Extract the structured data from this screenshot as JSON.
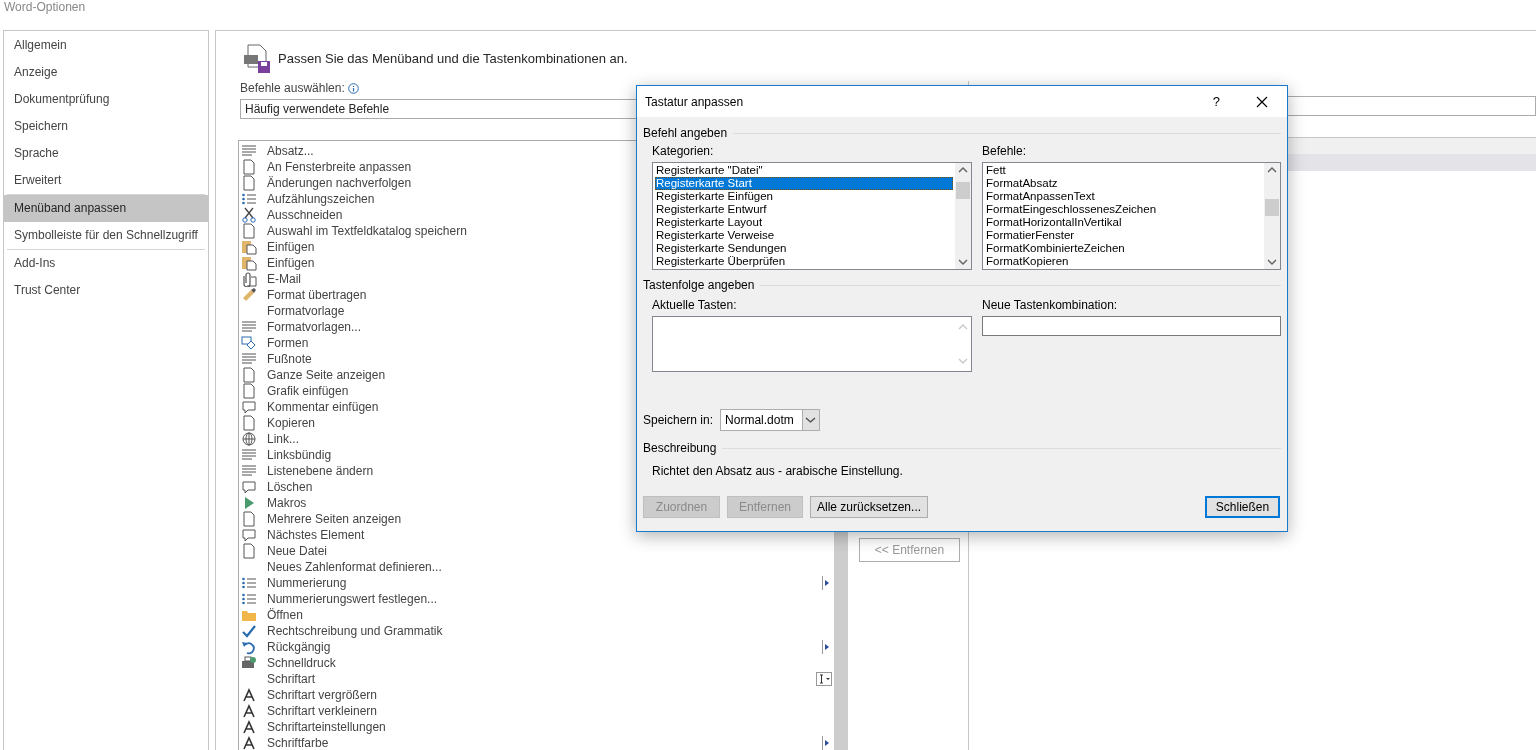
{
  "window": {
    "title": "Word-Optionen"
  },
  "sidebar": {
    "items": [
      {
        "label": "Allgemein",
        "selected": false,
        "divider_above": false
      },
      {
        "label": "Anzeige",
        "selected": false,
        "divider_above": false
      },
      {
        "label": "Dokumentprüfung",
        "selected": false,
        "divider_above": false
      },
      {
        "label": "Speichern",
        "selected": false,
        "divider_above": false
      },
      {
        "label": "Sprache",
        "selected": false,
        "divider_above": false
      },
      {
        "label": "Erweitert",
        "selected": false,
        "divider_above": false
      },
      {
        "label": "Menüband anpassen",
        "selected": true,
        "divider_above": true
      },
      {
        "label": "Symbolleiste für den Schnellzugriff",
        "selected": false,
        "divider_above": false
      },
      {
        "label": "Add-Ins",
        "selected": false,
        "divider_above": true
      },
      {
        "label": "Trust Center",
        "selected": false,
        "divider_above": false
      }
    ]
  },
  "main": {
    "heading": "Passen Sie das Menüband und die Tastenkombinationen an.",
    "select_label": "Befehle auswählen:",
    "select_value": "Häufig verwendete Befehle",
    "commands": [
      {
        "label": "Absatz..."
      },
      {
        "label": "An Fensterbreite anpassen"
      },
      {
        "label": "Änderungen nachverfolgen"
      },
      {
        "label": "Aufzählungszeichen"
      },
      {
        "label": "Ausschneiden"
      },
      {
        "label": "Auswahl im Textfeldkatalog speichern"
      },
      {
        "label": "Einfügen"
      },
      {
        "label": "Einfügen"
      },
      {
        "label": "E-Mail"
      },
      {
        "label": "Format übertragen"
      },
      {
        "label": "Formatvorlage"
      },
      {
        "label": "Formatvorlagen..."
      },
      {
        "label": "Formen"
      },
      {
        "label": "Fußnote"
      },
      {
        "label": "Ganze Seite anzeigen"
      },
      {
        "label": "Grafik einfügen"
      },
      {
        "label": "Kommentar einfügen"
      },
      {
        "label": "Kopieren"
      },
      {
        "label": "Link..."
      },
      {
        "label": "Linksbündig"
      },
      {
        "label": "Listenebene ändern"
      },
      {
        "label": "Löschen"
      },
      {
        "label": "Makros"
      },
      {
        "label": "Mehrere Seiten anzeigen"
      },
      {
        "label": "Nächstes Element"
      },
      {
        "label": "Neue Datei"
      },
      {
        "label": "Neues Zahlenformat definieren..."
      },
      {
        "label": "Nummerierung",
        "kind": "arrow"
      },
      {
        "label": "Nummerierungswert festlegen..."
      },
      {
        "label": "Öffnen"
      },
      {
        "label": "Rechtschreibung und Grammatik"
      },
      {
        "label": "Rückgängig",
        "kind": "arrow"
      },
      {
        "label": "Schnelldruck"
      },
      {
        "label": "Schriftart",
        "kind": "field"
      },
      {
        "label": "Schriftart vergrößern"
      },
      {
        "label": "Schriftart verkleinern"
      },
      {
        "label": "Schriftarteinstellungen"
      },
      {
        "label": "Schriftfarbe",
        "kind": "arrow"
      }
    ],
    "remove_button": {
      "label": "<< Entfernen",
      "disabled": true
    }
  },
  "dialog": {
    "title": "Tastatur anpassen",
    "help": "?",
    "command_section": "Befehl angeben",
    "categories": {
      "label": "Kategorien:",
      "items": [
        {
          "label": "Registerkarte \"Datei\"",
          "selected": false
        },
        {
          "label": "Registerkarte Start",
          "selected": true
        },
        {
          "label": "Registerkarte Einfügen",
          "selected": false
        },
        {
          "label": "Registerkarte Entwurf",
          "selected": false
        },
        {
          "label": "Registerkarte Layout",
          "selected": false
        },
        {
          "label": "Registerkarte Verweise",
          "selected": false
        },
        {
          "label": "Registerkarte Sendungen",
          "selected": false
        },
        {
          "label": "Registerkarte Überprüfen",
          "selected": false
        }
      ]
    },
    "commands": {
      "label": "Befehle:",
      "items": [
        {
          "label": "Fett",
          "selected": false
        },
        {
          "label": "FormatAbsatz",
          "selected": false
        },
        {
          "label": "FormatAnpassenText",
          "selected": false
        },
        {
          "label": "FormatEingeschlossenesZeichen",
          "selected": false
        },
        {
          "label": "FormatHorizontalInVertikal",
          "selected": false
        },
        {
          "label": "FormatierFenster",
          "selected": false
        },
        {
          "label": "FormatKombinierteZeichen",
          "selected": false
        },
        {
          "label": "FormatKopieren",
          "selected": false
        }
      ]
    },
    "keys_section": "Tastenfolge angeben",
    "current_keys": {
      "label": "Aktuelle Tasten:"
    },
    "new_keys": {
      "label": "Neue Tastenkombination:"
    },
    "save_in": {
      "label": "Speichern in:",
      "value": "Normal.dotm"
    },
    "description_section": "Beschreibung",
    "description": "Richtet den Absatz aus - arabische Einstellung.",
    "buttons": [
      {
        "label": "Zuordnen",
        "disabled": true,
        "default": false
      },
      {
        "label": "Entfernen",
        "disabled": true,
        "default": false
      },
      {
        "label": "Alle zurücksetzen...",
        "disabled": false,
        "default": false
      },
      {
        "label": "Schließen",
        "disabled": false,
        "default": true
      }
    ]
  }
}
